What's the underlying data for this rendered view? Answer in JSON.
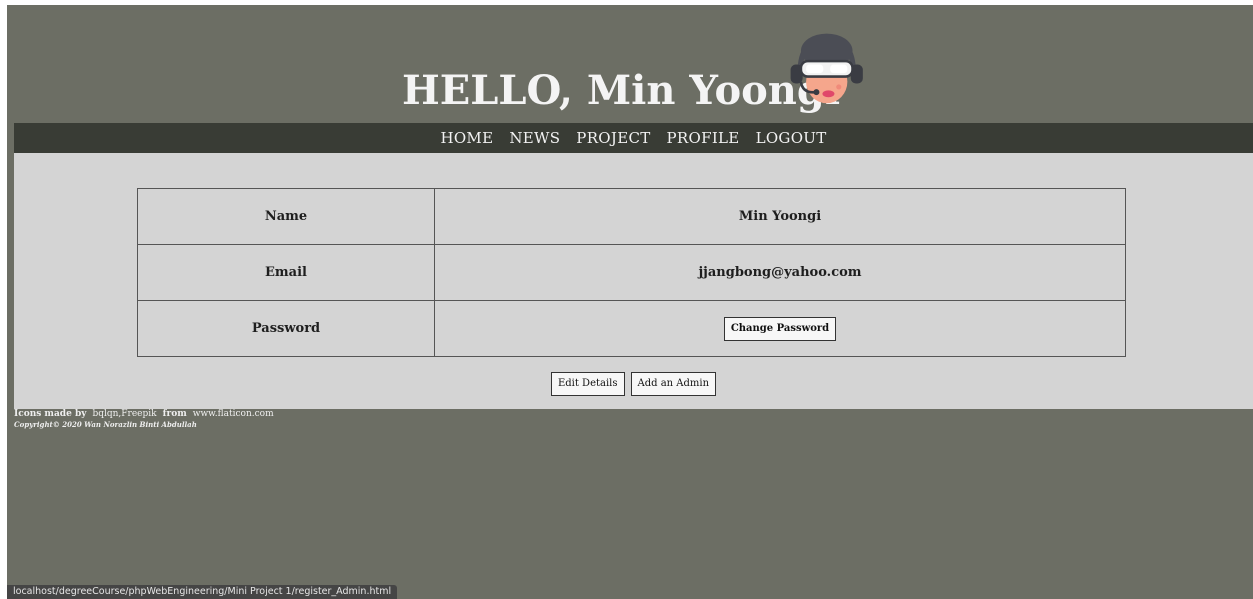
{
  "header": {
    "title": "HELLO, Min Yoongi",
    "avatar_icon": "pilot-avatar-icon"
  },
  "nav": {
    "items": [
      "HOME",
      "NEWS",
      "PROJECT",
      "PROFILE",
      "LOGOUT"
    ]
  },
  "profile": {
    "rows": [
      {
        "label": "Name",
        "value": "Min Yoongi"
      },
      {
        "label": "Email",
        "value": "jjangbong@yahoo.com"
      },
      {
        "label": "Password",
        "button": "Change Password"
      }
    ]
  },
  "actions": {
    "edit_label": "Edit Details",
    "add_admin_label": "Add an Admin"
  },
  "footer": {
    "icons_made_by": "Icons made by",
    "authors": "bqlqn,Freepik",
    "from": "from",
    "site": "www.flaticon.com",
    "copyright": "Copyright© 2020 Wan Norazlin Binti Abdullah"
  },
  "status_url": "localhost/degreeCourse/phpWebEngineering/Mini Project 1/register_Admin.html",
  "colors": {
    "page_background": "#6c6e64",
    "navbar": "#393c35",
    "panel": "#d4d4d4"
  }
}
